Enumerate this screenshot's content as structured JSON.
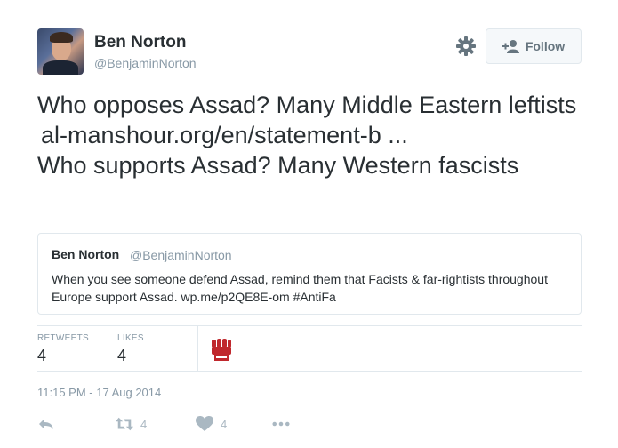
{
  "author": {
    "name": "Ben Norton",
    "handle": "@BenjaminNorton"
  },
  "header": {
    "settings_icon": "gear-icon",
    "follow_label": "Follow"
  },
  "tweet": {
    "line1": "Who opposes Assad? Many Middle Eastern leftists",
    "link": "al-manshour.org/en/statement-b  ...",
    "line2": "Who supports Assad? Many Western fascists"
  },
  "quote": {
    "name": "Ben Norton",
    "handle": "@BenjaminNorton",
    "text": "When you see someone defend Assad, remind them that Facists & far-rightists throughout Europe support Assad. wp.me/p2QE8E-om #AntiFa"
  },
  "stats": {
    "retweets_label": "RETWEETS",
    "retweets_value": "4",
    "likes_label": "LIKES",
    "likes_value": "4",
    "liker_icon": "red-fist-icon"
  },
  "timestamp": "11:15 PM - 17 Aug 2014",
  "actions": {
    "reply_icon": "reply-icon",
    "retweet_count": "4",
    "like_count": "4",
    "more_icon": "more-icon"
  },
  "colors": {
    "text": "#292f33",
    "muted": "#8899a6",
    "border": "#e1e8ed",
    "action_icon": "#aab8c2",
    "fist_red": "#c0282d"
  }
}
